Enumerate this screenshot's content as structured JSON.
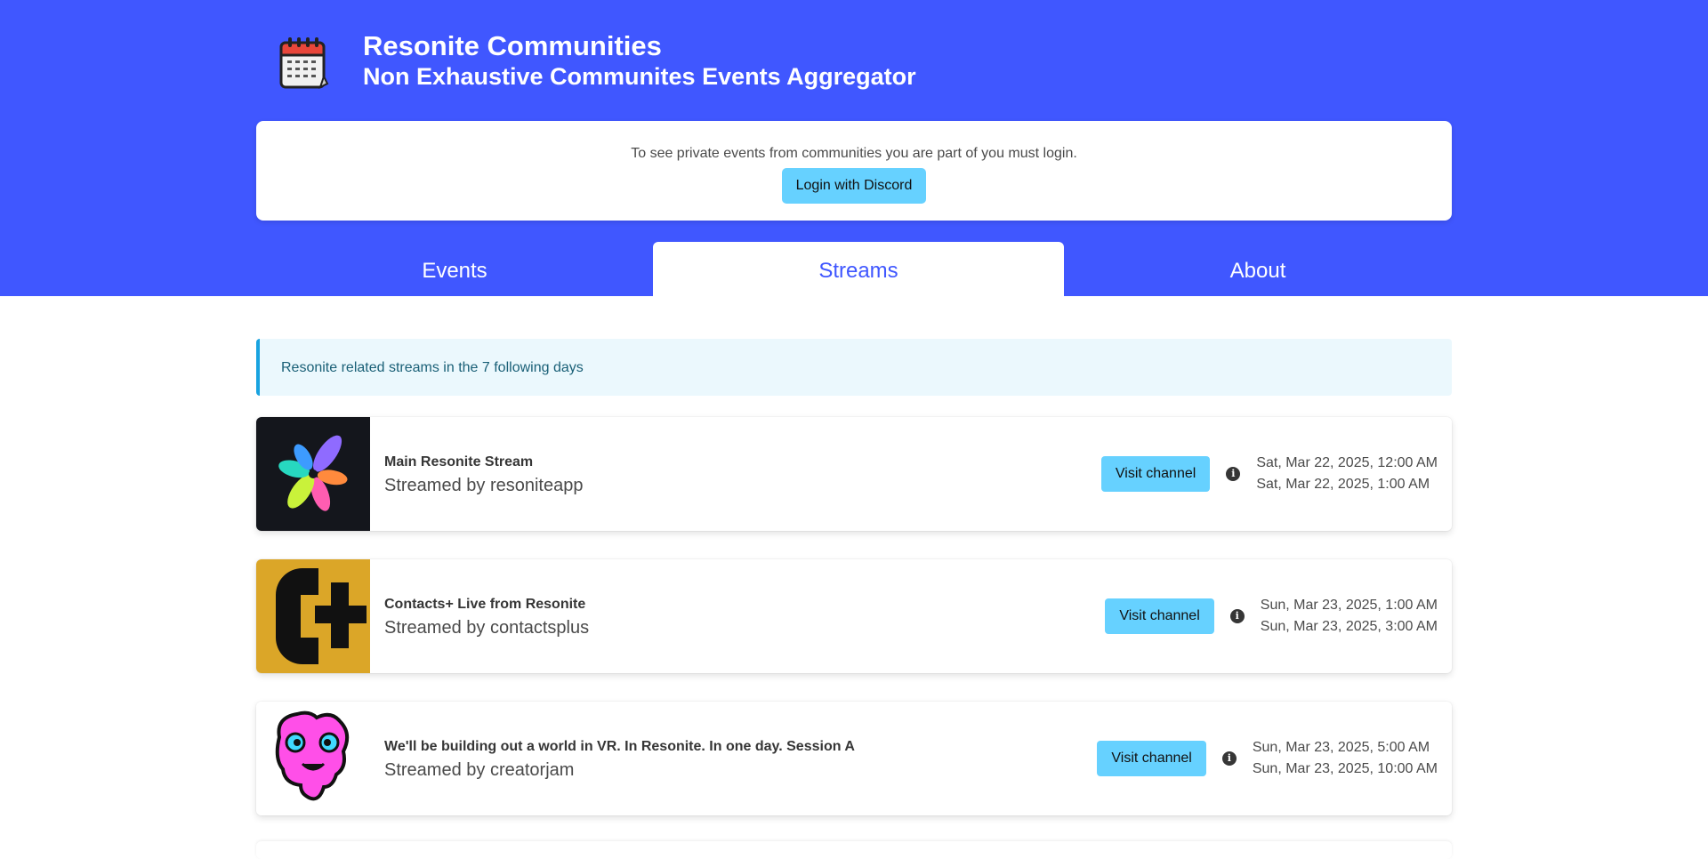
{
  "header": {
    "title": "Resonite Communities",
    "subtitle": "Non Exhaustive Communites Events Aggregator",
    "logo_icon": "calendar-icon"
  },
  "login": {
    "message": "To see private events from communities you are part of you must login.",
    "button_label": "Login with Discord"
  },
  "tabs": [
    {
      "label": "Events",
      "active": false
    },
    {
      "label": "Streams",
      "active": true
    },
    {
      "label": "About",
      "active": false
    }
  ],
  "notice": "Resonite related streams in the 7 following days",
  "streams": [
    {
      "title": "Main Resonite Stream",
      "streamed_by": "Streamed by resoniteapp",
      "button_label": "Visit channel",
      "start": "Sat, Mar 22, 2025, 12:00 AM",
      "end": "Sat, Mar 22, 2025, 1:00 AM"
    },
    {
      "title": "Contacts+ Live from Resonite",
      "streamed_by": "Streamed by contactsplus",
      "button_label": "Visit channel",
      "start": "Sun, Mar 23, 2025, 1:00 AM",
      "end": "Sun, Mar 23, 2025, 3:00 AM"
    },
    {
      "title": "We'll be building out a world in VR. In Resonite. In one day. Session A",
      "streamed_by": "Streamed by creatorjam",
      "button_label": "Visit channel",
      "start": "Sun, Mar 23, 2025, 5:00 AM",
      "end": "Sun, Mar 23, 2025, 10:00 AM"
    }
  ],
  "colors": {
    "hero": "#4057ff",
    "button": "#66d1ff",
    "notice_bg": "#ebf8fd",
    "notice_border": "#19a3e0"
  }
}
